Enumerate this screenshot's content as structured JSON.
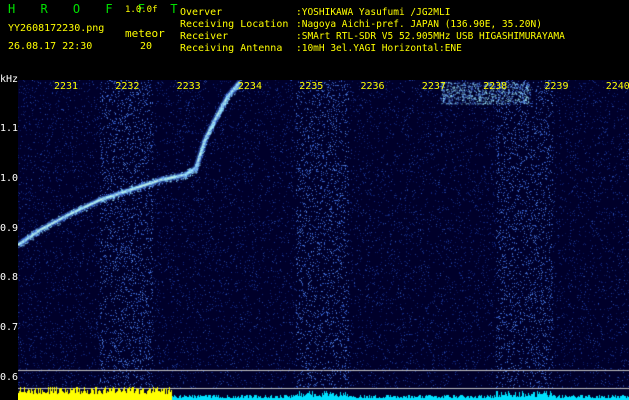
{
  "header": {
    "app_title": "H R O F F T",
    "version": "1.0.0f",
    "filename": "YY2608172230.png",
    "datetime": "26.08.17 22:30",
    "meteor_label": "meteor",
    "meteor_count": "20",
    "info_labels": [
      "Overver",
      "Receiving Location",
      "Receiver",
      "Receiving Antenna"
    ],
    "info_values": [
      ":YOSHIKAWA Yasufumi /JG2MLI",
      ":Nagoya Aichi-pref. JAPAN (136.90E, 35.20N)",
      ":SMArt RTL-SDR V5 52.905MHz USB HIGASHIMURAYAMA",
      ":10mH 3el.YAGI Horizontal:ENE"
    ]
  },
  "spectrogram": {
    "y_unit": "kHz",
    "y_ticks": [
      "1.1",
      "1.0",
      "0.9",
      "0.8",
      "0.7",
      "0.6"
    ],
    "y_values": [
      1.1,
      1.0,
      0.9,
      0.8,
      0.7,
      0.6
    ],
    "x_ticks": [
      "2231",
      "2232",
      "2233",
      "2234",
      "2235",
      "2236",
      "2237",
      "2238",
      "2239",
      "2240"
    ],
    "colors": {
      "background": "#00002a",
      "noise": "#1a3aa8",
      "noise_bright": "#3a6ae0",
      "band_bright": "#5a8ef0",
      "trace": "#9ff0ff",
      "trace_core": "#e8ffe0",
      "level_yellow": "#ffff00",
      "level_cyan": "#00e0ff",
      "guide_line": "#c0c0c0"
    }
  }
}
